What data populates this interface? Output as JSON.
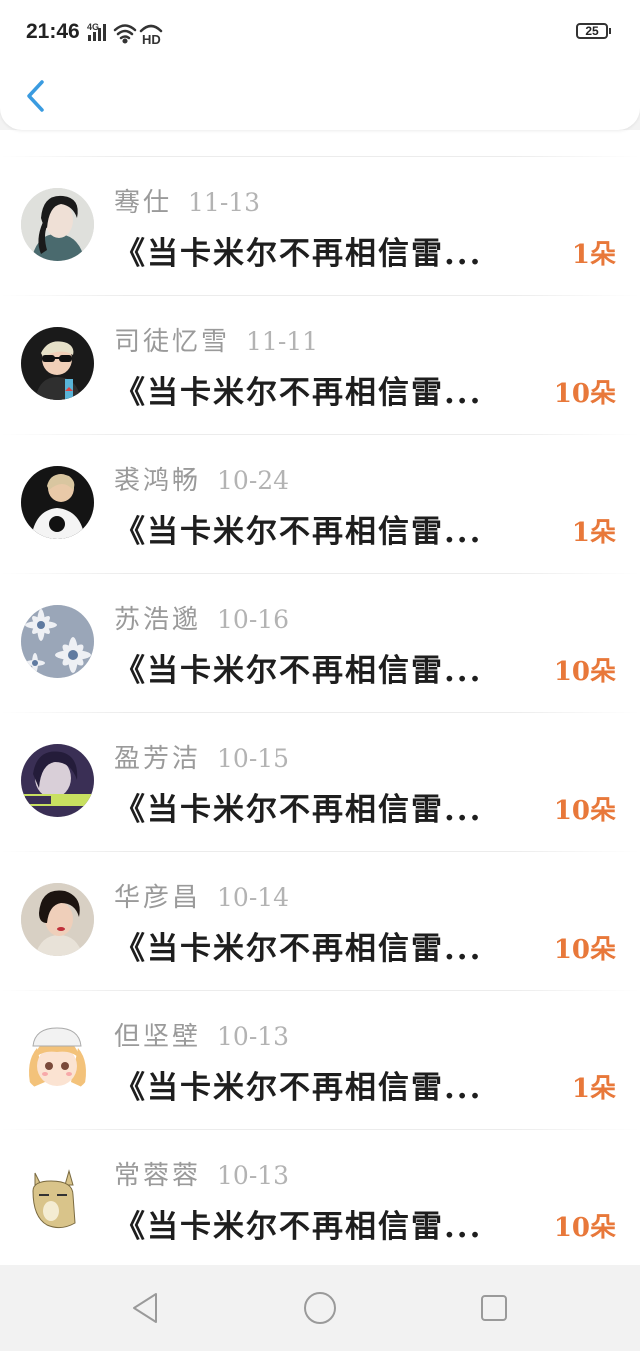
{
  "status_bar": {
    "time": "21:46",
    "battery": "25",
    "icons": [
      "network-4g-icon",
      "wifi-icon",
      "hd-icon",
      "battery-icon"
    ]
  },
  "header": {
    "back_icon": "chevron-left-icon",
    "accent_color": "#3a9be0"
  },
  "list": {
    "count_color": "#e8783a",
    "items": [
      {
        "name": "骞仕",
        "date": "11-13",
        "title": "《当卡米尔不再相信雷...",
        "count": "1朵",
        "avatar": "avatar-woman-black-hair"
      },
      {
        "name": "司徒忆雪",
        "date": "11-11",
        "title": "《当卡米尔不再相信雷...",
        "count": "10朵",
        "avatar": "avatar-kid-sunglasses"
      },
      {
        "name": "裘鸿畅",
        "date": "10-24",
        "title": "《当卡米尔不再相信雷...",
        "count": "1朵",
        "avatar": "avatar-child-tshirt"
      },
      {
        "name": "苏浩邈",
        "date": "10-16",
        "title": "《当卡米尔不再相信雷...",
        "count": "10朵",
        "avatar": "avatar-daisies"
      },
      {
        "name": "盈芳洁",
        "date": "10-15",
        "title": "《当卡米尔不再相信雷...",
        "count": "10朵",
        "avatar": "avatar-girl-purple"
      },
      {
        "name": "华彦昌",
        "date": "10-14",
        "title": "《当卡米尔不再相信雷...",
        "count": "10朵",
        "avatar": "avatar-woman-vintage"
      },
      {
        "name": "但坚壁",
        "date": "10-13",
        "title": "《当卡米尔不再相信雷...",
        "count": "1朵",
        "avatar": "avatar-anime-girl"
      },
      {
        "name": "常蓉蓉",
        "date": "10-13",
        "title": "《当卡米尔不再相信雷...",
        "count": "10朵",
        "avatar": "avatar-cartoon-alpaca"
      }
    ]
  },
  "nav_bar": {
    "back": "nav-back-icon",
    "home": "nav-home-icon",
    "recents": "nav-recents-icon"
  }
}
